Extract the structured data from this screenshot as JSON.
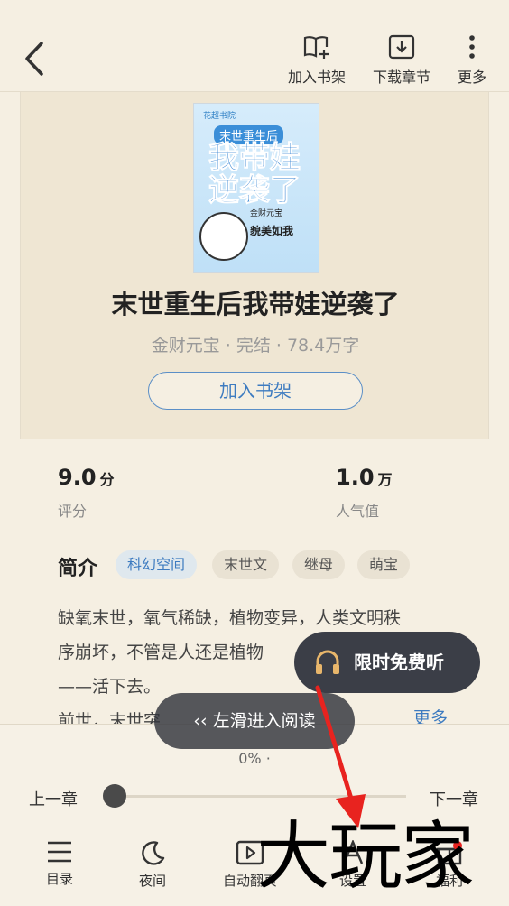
{
  "topbar": {
    "actions": [
      {
        "label": "加入书架",
        "icon": "book-add-icon"
      },
      {
        "label": "下载章节",
        "icon": "download-icon"
      },
      {
        "label": "更多",
        "icon": "more-vertical-icon"
      }
    ]
  },
  "book": {
    "cover": {
      "publisher": "花超书院",
      "series": "末世重生后",
      "title_art": "我带娃逆袭了",
      "author": "金财元宝",
      "slogan": "貌美如我"
    },
    "title": "末世重生后我带娃逆袭了",
    "meta": "金财元宝 · 完结 · 78.4万字",
    "add_shelf_label": "加入书架"
  },
  "stats": [
    {
      "value": "9.0",
      "unit": "分",
      "label": "评分"
    },
    {
      "value": "1.0",
      "unit": "万",
      "label": "人气值"
    }
  ],
  "intro": {
    "heading": "简介",
    "tags": [
      "科幻空间",
      "末世文",
      "继母",
      "萌宝"
    ],
    "lines": [
      "缺氧末世，氧气稀缺，植物变异，人类文明秩",
      "序崩坏，不管是人还是植物",
      "——活下去。",
      "前世，末世突"
    ],
    "more_label": "更多"
  },
  "listen_button": "限时免费听",
  "swipe_hint": "‹‹ 左滑进入阅读",
  "reader": {
    "percent": "0% ·",
    "prev": "上一章",
    "next": "下一章",
    "nav": [
      {
        "label": "目录",
        "icon": "list-icon"
      },
      {
        "label": "夜间",
        "icon": "moon-icon"
      },
      {
        "label": "自动翻页",
        "icon": "play-icon"
      },
      {
        "label": "设置",
        "icon": "font-icon"
      },
      {
        "label": "福利",
        "icon": "gift-icon"
      }
    ]
  },
  "watermark": "大玩家",
  "colors": {
    "accent": "#3d7bc0",
    "background": "#f5efe2",
    "annotation": "#e8231f"
  }
}
